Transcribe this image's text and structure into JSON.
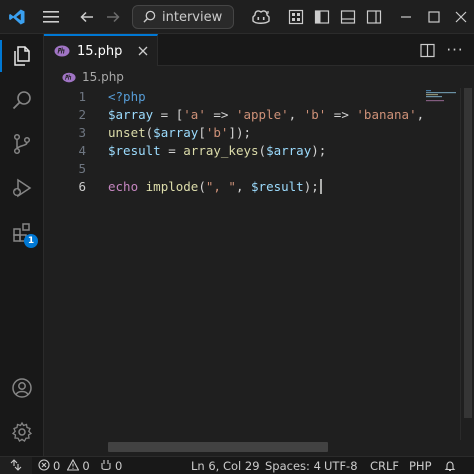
{
  "titlebar": {
    "search_label": "interview",
    "icons": [
      "vscode-logo-icon",
      "menu-icon",
      "arrow-left-icon",
      "arrow-right-icon",
      "search-icon",
      "copilot-icon",
      "layout-icon",
      "toggle-sidebar-icon",
      "toggle-panel-icon",
      "toggle-secondary-sidebar-icon",
      "minimize-icon",
      "maximize-icon",
      "close-icon"
    ]
  },
  "activitybar": {
    "items": [
      "explorer-icon",
      "search-icon",
      "source-control-icon",
      "run-debug-icon",
      "extensions-icon"
    ],
    "extensions_badge": "1",
    "bottom": [
      "accounts-icon",
      "manage-gear-icon"
    ]
  },
  "tab": {
    "label": "15.php"
  },
  "breadcrumb": {
    "file": "15.php"
  },
  "editor": {
    "line_numbers": [
      "1",
      "2",
      "3",
      "4",
      "5",
      "6"
    ],
    "current_line": "6",
    "lines": [
      [
        {
          "t": "<?php",
          "c": "c-tag"
        }
      ],
      [
        {
          "t": "$array",
          "c": "c-var"
        },
        {
          "t": " = [",
          "c": "c-pl"
        },
        {
          "t": "'a'",
          "c": "c-str"
        },
        {
          "t": " => ",
          "c": "c-pl"
        },
        {
          "t": "'apple'",
          "c": "c-str"
        },
        {
          "t": ", ",
          "c": "c-pl"
        },
        {
          "t": "'b'",
          "c": "c-str"
        },
        {
          "t": " => ",
          "c": "c-pl"
        },
        {
          "t": "'banana'",
          "c": "c-str"
        },
        {
          "t": ", ",
          "c": "c-pl"
        }
      ],
      [
        {
          "t": "unset",
          "c": "c-fn"
        },
        {
          "t": "(",
          "c": "c-pl"
        },
        {
          "t": "$array",
          "c": "c-var"
        },
        {
          "t": "[",
          "c": "c-pl"
        },
        {
          "t": "'b'",
          "c": "c-str"
        },
        {
          "t": "]);",
          "c": "c-pl"
        }
      ],
      [
        {
          "t": "$result",
          "c": "c-var"
        },
        {
          "t": " = ",
          "c": "c-pl"
        },
        {
          "t": "array_keys",
          "c": "c-fn"
        },
        {
          "t": "(",
          "c": "c-pl"
        },
        {
          "t": "$array",
          "c": "c-var"
        },
        {
          "t": ");",
          "c": "c-pl"
        }
      ],
      [],
      [
        {
          "t": "echo",
          "c": "c-kw"
        },
        {
          "t": " ",
          "c": "c-pl"
        },
        {
          "t": "implode",
          "c": "c-fn"
        },
        {
          "t": "(",
          "c": "c-pl"
        },
        {
          "t": "\", \"",
          "c": "c-str"
        },
        {
          "t": ", ",
          "c": "c-pl"
        },
        {
          "t": "$result",
          "c": "c-var"
        },
        {
          "t": ");",
          "c": "c-pl"
        }
      ]
    ]
  },
  "statusbar": {
    "errors": "0",
    "warnings": "0",
    "ports": "0",
    "position": "Ln 6, Col 29",
    "spaces": "Spaces: 4",
    "encoding": "UTF-8",
    "eol": "CRLF",
    "language": "PHP"
  },
  "colors": {
    "accent": "#0078d4",
    "background": "#1f1f1f"
  }
}
